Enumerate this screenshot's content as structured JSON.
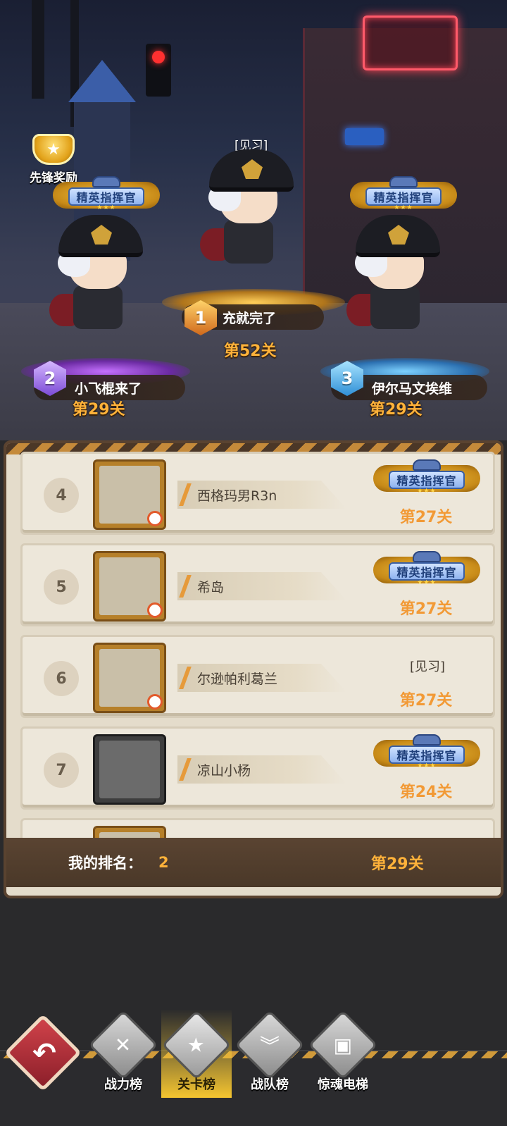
{
  "scene": {
    "reward_label": "先锋奖励",
    "podium": [
      {
        "rank": "1",
        "name": "充就完了",
        "title": "[见习]",
        "stage": "第52关",
        "badge": ""
      },
      {
        "rank": "2",
        "name": "小飞棍来了",
        "title": "",
        "stage": "第29关",
        "badge": "精英指挥官"
      },
      {
        "rank": "3",
        "name": "伊尔马文埃维",
        "title": "",
        "stage": "第29关",
        "badge": "精英指挥官"
      }
    ]
  },
  "leaderboard": {
    "rows": [
      {
        "rank": "4",
        "name": "西格玛男R3n",
        "badge": "精英指挥官",
        "title": "",
        "stage": "第27关"
      },
      {
        "rank": "5",
        "name": "希岛",
        "badge": "精英指挥官",
        "title": "",
        "stage": "第27关"
      },
      {
        "rank": "6",
        "name": "尔逊帕利葛兰",
        "badge": "",
        "title": "[见习]",
        "stage": "第27关"
      },
      {
        "rank": "7",
        "name": "凉山小杨",
        "badge": "精英指挥官",
        "title": "",
        "stage": "第24关"
      }
    ],
    "my_rank": {
      "label": "我的排名：",
      "value": "2",
      "stage": "第29关"
    }
  },
  "nav": {
    "tabs": [
      {
        "label": "战力榜",
        "icon": "crossed-guns-icon",
        "active": false
      },
      {
        "label": "关卡榜",
        "icon": "star-medal-icon",
        "active": true
      },
      {
        "label": "战队榜",
        "icon": "shield-chevron-icon",
        "active": false
      },
      {
        "label": "惊魂电梯",
        "icon": "elevator-box-icon",
        "active": false
      }
    ]
  },
  "colors": {
    "accent": "#ffb23a",
    "board_bg": "#e4dccb",
    "active_tab": "#f5c530"
  }
}
